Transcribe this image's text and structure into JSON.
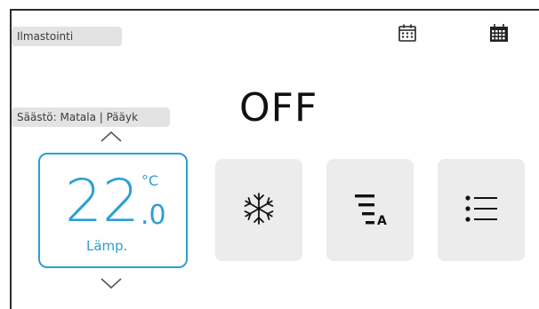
{
  "header": {
    "mode_label": "Ilmastointi",
    "save_label": "Säästö: Matala | Pääyk",
    "schedule_icon": "calendar-icon",
    "weekly_schedule_icon": "calendar-grid-icon"
  },
  "status": {
    "power": "OFF"
  },
  "temperature": {
    "integer": "22",
    "decimal": ".0",
    "unit": "°C",
    "label": "Lämp.",
    "color": "#2d9fd4"
  },
  "controls": {
    "mode_icon": "snowflake-icon",
    "fan_icon": "fan-speed-auto-icon",
    "fan_badge": "A",
    "menu_icon": "list-menu-icon",
    "tile_color": "#ececec"
  }
}
